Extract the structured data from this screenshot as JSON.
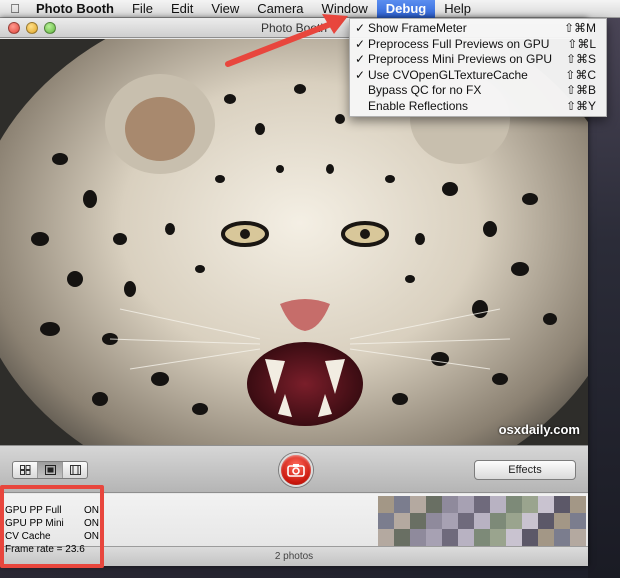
{
  "menubar": {
    "apple_icon": "apple-icon",
    "items": [
      {
        "label": "Photo Booth"
      },
      {
        "label": "File"
      },
      {
        "label": "Edit"
      },
      {
        "label": "View"
      },
      {
        "label": "Camera"
      },
      {
        "label": "Window"
      },
      {
        "label": "Debug"
      },
      {
        "label": "Help"
      }
    ],
    "active_item": "Debug"
  },
  "window": {
    "title": "Photo Booth"
  },
  "debug_menu": {
    "items": [
      {
        "label": "Show FrameMeter",
        "checked": "✓",
        "shortcut": "⇧⌘M"
      },
      {
        "label": "Preprocess Full Previews on GPU",
        "checked": "✓",
        "shortcut": "⇧⌘L"
      },
      {
        "label": "Preprocess Mini Previews on GPU",
        "checked": "✓",
        "shortcut": "⇧⌘S"
      },
      {
        "label": "Use CVOpenGLTextureCache",
        "checked": "✓",
        "shortcut": "⇧⌘C"
      },
      {
        "label": "Bypass QC for no FX",
        "checked": "",
        "shortcut": "⇧⌘B"
      },
      {
        "label": "Enable Reflections",
        "checked": "",
        "shortcut": "⇧⌘Y"
      }
    ]
  },
  "preview": {
    "watermark": "osxdaily.com"
  },
  "toolbar": {
    "view_modes": [
      "grid-view-icon",
      "single-view-icon",
      "filmstrip-view-icon"
    ],
    "selected_view": "single-view-icon",
    "capture_icon": "camera-icon",
    "effects_label": "Effects"
  },
  "framemeter": {
    "rows": [
      {
        "label": "GPU PP Full",
        "value": "ON"
      },
      {
        "label": "GPU PP Mini",
        "value": "ON"
      },
      {
        "label": "CV Cache",
        "value": "ON"
      },
      {
        "label": "Frame rate = 23.6",
        "value": ""
      }
    ]
  },
  "tray": {
    "status": "2 photos"
  },
  "colors": {
    "accent": "#2d63d6",
    "annotation_red": "#e8463d",
    "capture_red": "#c9150b"
  }
}
